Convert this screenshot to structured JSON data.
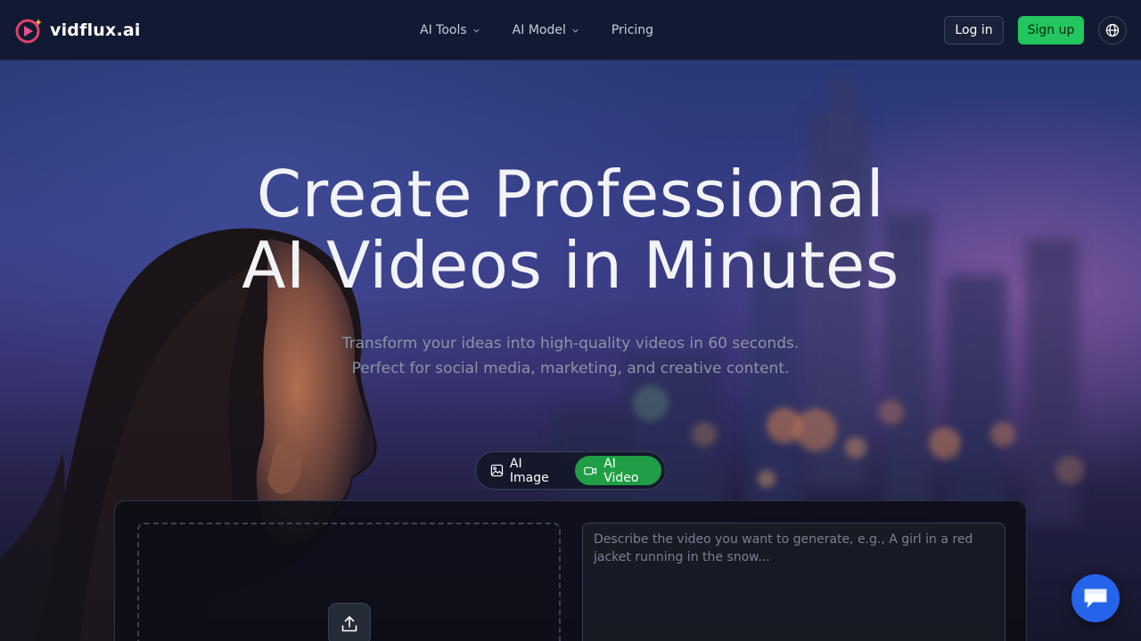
{
  "brand": {
    "name": "vidflux.ai"
  },
  "nav": {
    "items": [
      {
        "label": "AI Tools",
        "has_dropdown": true
      },
      {
        "label": "AI Model",
        "has_dropdown": true
      },
      {
        "label": "Pricing",
        "has_dropdown": false
      }
    ]
  },
  "auth": {
    "login_label": "Log in",
    "signup_label": "Sign up"
  },
  "hero": {
    "title_line1": "Create Professional",
    "title_line2": "AI Videos in Minutes",
    "subtitle_line1": "Transform your ideas into high-quality videos in 60 seconds.",
    "subtitle_line2": "Perfect for social media, marketing, and creative content."
  },
  "mode_toggle": {
    "tabs": [
      {
        "label": "AI Image",
        "icon": "image-icon",
        "active": false
      },
      {
        "label": "AI Video",
        "icon": "video-camera-icon",
        "active": true
      }
    ]
  },
  "generator": {
    "prompt_placeholder": "Describe the video you want to generate, e.g., A girl in a red jacket running in the snow...",
    "upload_icon": "upload-icon"
  },
  "icons": {
    "language": "globe-icon",
    "chat": "chat-icon"
  },
  "colors": {
    "accent_green": "#22c55e",
    "active_tab": "#1f9e46",
    "chat_blue": "#2563eb",
    "header_bg": "#121a33"
  }
}
